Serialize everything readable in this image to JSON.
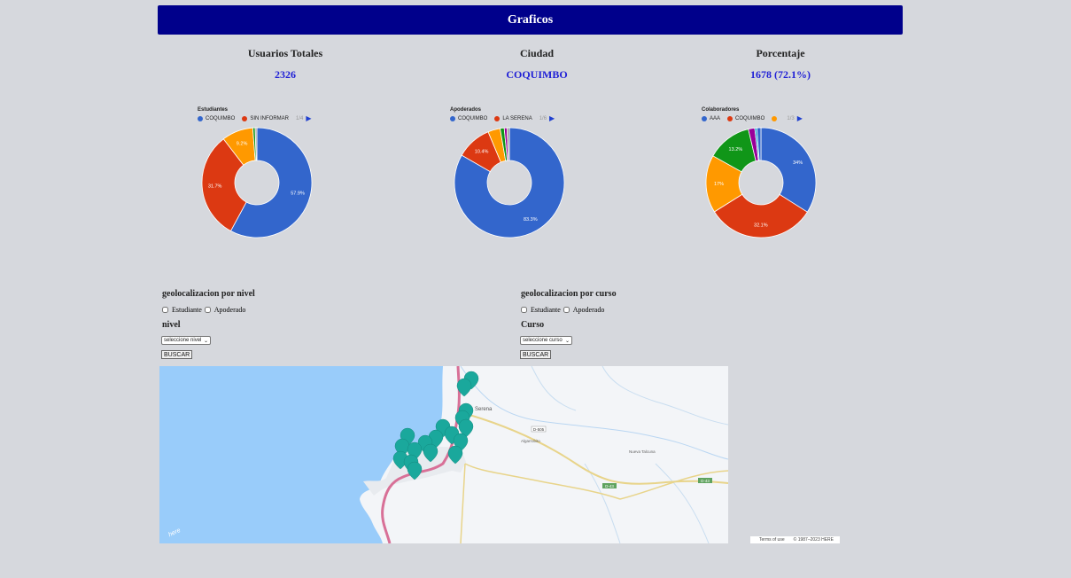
{
  "header": {
    "title": "Graficos"
  },
  "stats": [
    {
      "label": "Usuarios Totales",
      "value": "2326"
    },
    {
      "label": "Ciudad",
      "value": "COQUIMBO"
    },
    {
      "label": "Porcentaje",
      "value": "1678 (72.1%)"
    }
  ],
  "charts": [
    {
      "legend_title": "Estudiantes",
      "legend": [
        {
          "name": "COQUIMBO",
          "color": "#3366cc"
        },
        {
          "name": "SIN INFORMAR",
          "color": "#dc3912"
        }
      ],
      "pager": "1/4",
      "slices": [
        {
          "value": 57.9,
          "color": "#3366cc",
          "label": "57.9%"
        },
        {
          "value": 31.7,
          "color": "#dc3912",
          "label": "31.7%"
        },
        {
          "value": 9.2,
          "color": "#ff9900",
          "label": "9.2%"
        },
        {
          "value": 0.7,
          "color": "#109618",
          "label": ""
        },
        {
          "value": 0.5,
          "color": "#999999",
          "label": ""
        }
      ]
    },
    {
      "legend_title": "Apoderados",
      "legend": [
        {
          "name": "COQUIMBO",
          "color": "#3366cc"
        },
        {
          "name": "LA SERENA",
          "color": "#dc3912"
        }
      ],
      "pager": "1/6",
      "slices": [
        {
          "value": 83.3,
          "color": "#3366cc",
          "label": "83.3%"
        },
        {
          "value": 10.4,
          "color": "#dc3912",
          "label": "10.4%"
        },
        {
          "value": 3.6,
          "color": "#ff9900",
          "label": ""
        },
        {
          "value": 1.2,
          "color": "#109618",
          "label": ""
        },
        {
          "value": 0.8,
          "color": "#990099",
          "label": ""
        },
        {
          "value": 0.7,
          "color": "#999999",
          "label": ""
        }
      ]
    },
    {
      "legend_title": "Colaboradores",
      "legend": [
        {
          "name": "AAA",
          "color": "#3366cc"
        },
        {
          "name": "COQUIMBO",
          "color": "#dc3912"
        },
        {
          "name": "",
          "color": "#ff9900"
        }
      ],
      "pager": "1/3",
      "slices": [
        {
          "value": 34,
          "color": "#3366cc",
          "label": "34%"
        },
        {
          "value": 32.1,
          "color": "#dc3912",
          "label": "32.1%"
        },
        {
          "value": 17,
          "color": "#ff9900",
          "label": "17%"
        },
        {
          "value": 13.2,
          "color": "#109618",
          "label": "13.2%"
        },
        {
          "value": 1.9,
          "color": "#990099",
          "label": ""
        },
        {
          "value": 0.6,
          "color": "#0099c6",
          "label": ""
        },
        {
          "value": 1.2,
          "color": "#3366cc",
          "label": ""
        }
      ]
    }
  ],
  "geo_nivel": {
    "title": "geolocalizacion por nivel",
    "check1": "Estudiante",
    "check2": "Apoderado",
    "select_label": "nivel",
    "select_value": "seleccione nivel",
    "button": "BUSCAR"
  },
  "geo_curso": {
    "title": "geolocalizacion por curso",
    "check1": "Estudiante",
    "check2": "Apoderado",
    "select_label": "Curso",
    "select_value": "seleccione curso",
    "button": "BUSCAR"
  },
  "map": {
    "place_serena": "Serena",
    "place_altovalsol": "Algarrobito",
    "place_nueva": "Nueva Talcuna",
    "road1": "D-505",
    "road2": "D-43",
    "road3": "D-43",
    "logo": "here",
    "terms": "Terms of use",
    "copyright": "© 1987–2023 HERE"
  }
}
